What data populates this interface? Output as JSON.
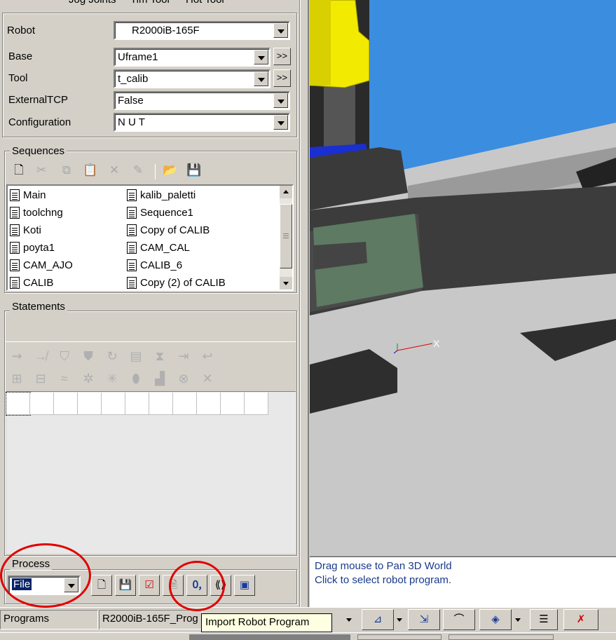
{
  "tabs": {
    "jog_joints": "Jog Joints",
    "tim_tool": "Tim Tool",
    "hot_tool": "Hot Tool"
  },
  "robot_panel": {
    "robot_label": "Robot",
    "robot_value": "R2000iB-165F",
    "base_label": "Base",
    "base_value": "Uframe1",
    "tool_label": "Tool",
    "tool_value": "t_calib",
    "external_tcp_label": "ExternalTCP",
    "external_tcp_value": "False",
    "configuration_label": "Configuration",
    "configuration_value": "N U T",
    "more_button": ">>"
  },
  "sequences": {
    "title": "Sequences",
    "items": [
      "Main",
      "kalib_paletti",
      "toolchng",
      "Sequence1",
      "Koti",
      "Copy of CALIB",
      "poyta1",
      "CAM_CAL",
      "CAM_AJO",
      "CALIB_6",
      "CALIB",
      "Copy (2) of CALIB"
    ]
  },
  "statements": {
    "title": "Statements"
  },
  "process": {
    "title": "Process",
    "selected": "File"
  },
  "messages": {
    "line1": "Drag mouse to Pan 3D World",
    "line2": "Click to select robot program."
  },
  "statusbar": {
    "programs": "Programs",
    "robot_program": "R2000iB-165F_Prog"
  },
  "tooltip": "Import Robot Program",
  "axis": {
    "x_label": "X"
  },
  "colors": {
    "robot_yellow": "#f2ea00",
    "sky_blue": "#3b8de0",
    "floor_gray": "#c8c8c8",
    "annotation_red": "#e00000",
    "message_text": "#1a3a8a",
    "tooltip_bg": "#ffffe1"
  }
}
